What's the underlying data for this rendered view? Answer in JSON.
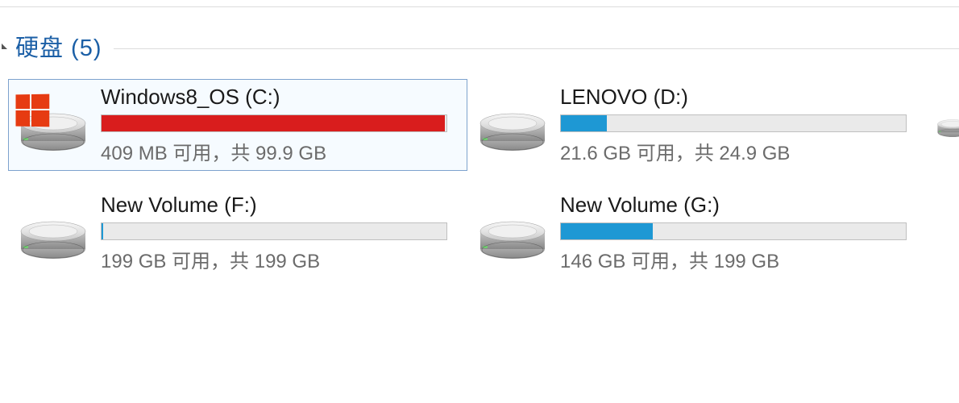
{
  "section": {
    "title": "硬盘 (5)"
  },
  "drives": [
    {
      "name": "Windows8_OS (C:)",
      "status": "409 MB 可用，共 99.9 GB",
      "fill_percent": 99.6,
      "critical": true,
      "os_logo": true,
      "selected": true
    },
    {
      "name": "LENOVO (D:)",
      "status": "21.6 GB 可用，共 24.9 GB",
      "fill_percent": 13.3,
      "critical": false,
      "os_logo": false,
      "selected": false
    },
    {
      "name": "New Volume (F:)",
      "status": "199 GB 可用，共 199 GB",
      "fill_percent": 0.5,
      "critical": false,
      "os_logo": false,
      "selected": false
    },
    {
      "name": "New Volume (G:)",
      "status": "146 GB 可用，共 199 GB",
      "fill_percent": 26.6,
      "critical": false,
      "os_logo": false,
      "selected": false
    }
  ]
}
